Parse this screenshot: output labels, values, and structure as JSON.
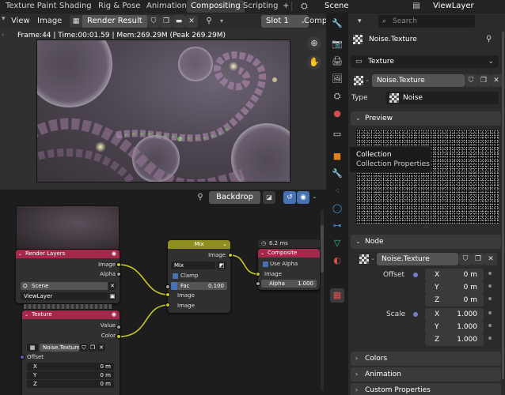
{
  "topbar": {
    "tabs": [
      "Texture Paint",
      "Shading",
      "Rig & Pose",
      "Animation",
      "Compositing",
      "Scripting"
    ],
    "active_tab": "Compositing",
    "add_tab": "+",
    "scene": "Scene",
    "view_layer": "ViewLayer"
  },
  "image_editor": {
    "menu_view": "View",
    "menu_image": "Image",
    "image_name": "Render Result",
    "slot": "Slot 1",
    "compositor_partial": "Compo",
    "stats": "Frame:44 | Time:00:01.59 | Mem:269.29M (Peak 269.29M)"
  },
  "node_editor": {
    "backdrop_label": "Backdrop",
    "render_layers": {
      "title": "Render Layers",
      "out_image": "Image",
      "out_alpha": "Alpha",
      "scene": "Scene",
      "view_layer": "ViewLayer"
    },
    "mix": {
      "title": "Mix",
      "out_image": "Image",
      "blend": "Mix",
      "clamp": "Clamp",
      "fac_label": "Fac",
      "fac_value": "0.100",
      "in_image1": "Image",
      "in_image2": "Image"
    },
    "composite": {
      "timing": "6.2 ms",
      "title": "Composite",
      "use_alpha": "Use Alpha",
      "in_image": "Image",
      "alpha_label": "Alpha",
      "alpha_value": "1.000"
    },
    "texture": {
      "title": "Texture",
      "out_value": "Value",
      "out_color": "Color",
      "texture_name": "Noise.Texture",
      "offset_label": "Offset",
      "x_label": "X",
      "x_value": "0 m",
      "y_label": "Y",
      "y_value": "0 m",
      "z_label": "Z",
      "z_value": "0 m"
    }
  },
  "properties": {
    "search_placeholder": "Search",
    "texture_name_header": "Noise.Texture",
    "context": "Texture",
    "texture_name": "Noise.Texture",
    "type_label": "Type",
    "type_value": "Noise",
    "preview_panel": "Preview",
    "node_panel": "Node",
    "node_texture_name": "Noise.Texture",
    "offset_label": "Offset",
    "offset": {
      "x_label": "X",
      "x": "0 m",
      "y_label": "Y",
      "y": "0 m",
      "z_label": "Z",
      "z": "0 m"
    },
    "scale_label": "Scale",
    "scale": {
      "x_label": "X",
      "x": "1.000",
      "y_label": "Y",
      "y": "1.000",
      "z_label": "Z",
      "z": "1.000"
    },
    "colors_panel": "Colors",
    "animation_panel": "Animation",
    "custom_props_panel": "Custom Properties",
    "tooltip_title": "Collection",
    "tooltip_desc": "Collection Properties"
  },
  "colors": {
    "active_tab_bg": "#3d3d3d",
    "node_render_layers": "#a3284a",
    "node_mix": "#8f8f1f",
    "node_composite": "#a3284a",
    "node_texture": "#a3284a",
    "link_yellow": "#c7c729",
    "accent_blue": "#4772b3"
  }
}
